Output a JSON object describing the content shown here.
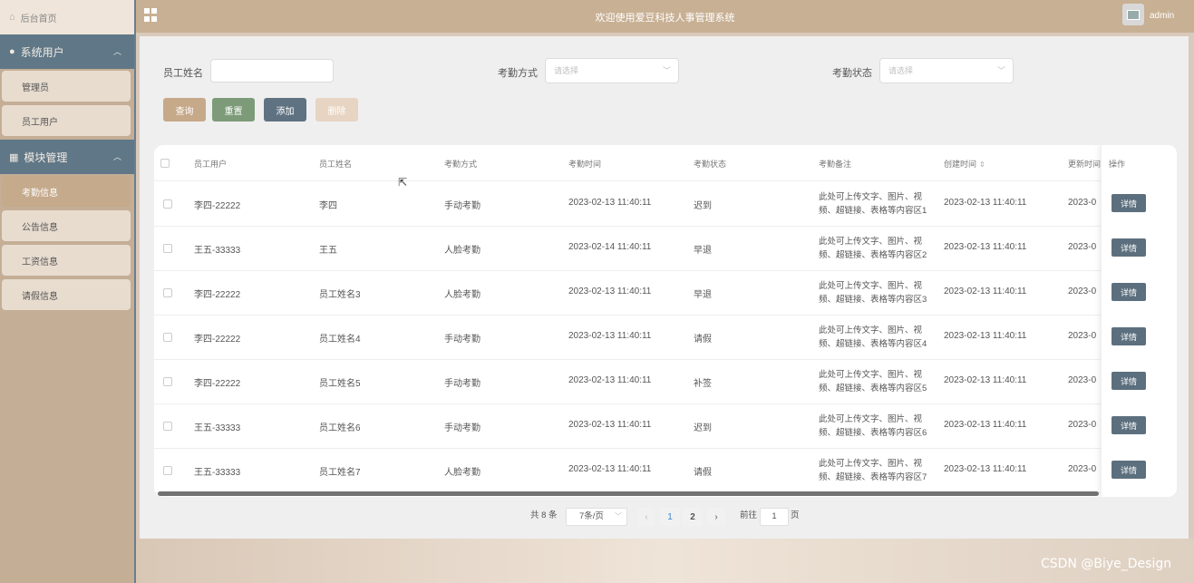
{
  "sidebar": {
    "home": "后台首页",
    "groups": [
      {
        "title": "系统用户",
        "items": [
          "管理员",
          "员工用户"
        ]
      },
      {
        "title": "模块管理",
        "items": [
          "考勤信息",
          "公告信息",
          "工资信息",
          "请假信息"
        ]
      }
    ],
    "active_item": "考勤信息"
  },
  "header": {
    "title": "欢迎使用爱豆科技人事管理系统",
    "user": "admin"
  },
  "filters": {
    "name_label": "员工姓名",
    "method_label": "考勤方式",
    "method_placeholder": "请选择",
    "status_label": "考勤状态",
    "status_placeholder": "请选择"
  },
  "buttons": {
    "search": "查询",
    "reset": "重置",
    "add": "添加",
    "delete": "删除",
    "detail": "详情"
  },
  "table": {
    "columns": [
      "员工用户",
      "员工姓名",
      "考勤方式",
      "考勤时间",
      "考勤状态",
      "考勤备注",
      "创建时间",
      "更新时间",
      "操作"
    ],
    "rows": [
      {
        "user": "李四-22222",
        "name": "李四",
        "method": "手动考勤",
        "time": "2023-02-13 11:40:11",
        "status": "迟到",
        "remark": "此处可上传文字、图片、视频、超链接、表格等内容区1",
        "created": "2023-02-13 11:40:11",
        "updated": "2023-0"
      },
      {
        "user": "王五-33333",
        "name": "王五",
        "method": "人脸考勤",
        "time": "2023-02-14 11:40:11",
        "status": "早退",
        "remark": "此处可上传文字、图片、视频、超链接、表格等内容区2",
        "created": "2023-02-13 11:40:11",
        "updated": "2023-0"
      },
      {
        "user": "李四-22222",
        "name": "员工姓名3",
        "method": "人脸考勤",
        "time": "2023-02-13 11:40:11",
        "status": "早退",
        "remark": "此处可上传文字、图片、视频、超链接、表格等内容区3",
        "created": "2023-02-13 11:40:11",
        "updated": "2023-0"
      },
      {
        "user": "李四-22222",
        "name": "员工姓名4",
        "method": "手动考勤",
        "time": "2023-02-13 11:40:11",
        "status": "请假",
        "remark": "此处可上传文字、图片、视频、超链接、表格等内容区4",
        "created": "2023-02-13 11:40:11",
        "updated": "2023-0"
      },
      {
        "user": "李四-22222",
        "name": "员工姓名5",
        "method": "手动考勤",
        "time": "2023-02-13 11:40:11",
        "status": "补签",
        "remark": "此处可上传文字、图片、视频、超链接、表格等内容区5",
        "created": "2023-02-13 11:40:11",
        "updated": "2023-0"
      },
      {
        "user": "王五-33333",
        "name": "员工姓名6",
        "method": "手动考勤",
        "time": "2023-02-13 11:40:11",
        "status": "迟到",
        "remark": "此处可上传文字、图片、视频、超链接、表格等内容区6",
        "created": "2023-02-13 11:40:11",
        "updated": "2023-0"
      },
      {
        "user": "王五-33333",
        "name": "员工姓名7",
        "method": "人脸考勤",
        "time": "2023-02-13 11:40:11",
        "status": "请假",
        "remark": "此处可上传文字、图片、视频、超链接、表格等内容区7",
        "created": "2023-02-13 11:40:11",
        "updated": "2023-0"
      }
    ]
  },
  "pagination": {
    "total": "共 8 条",
    "page_size": "7条/页",
    "pages": [
      "1",
      "2"
    ],
    "current": "1",
    "goto_prefix": "前往",
    "goto_value": "1",
    "goto_suffix": "页"
  },
  "watermark": "CSDN @Biye_Design",
  "colors": {
    "sidebar_group": "#607787",
    "active_item": "#c5aa8c",
    "search_btn": "#c6a989",
    "reset_btn": "#7d9b79",
    "add_btn": "#5f7282",
    "delete_btn": "#e7d4c2"
  }
}
